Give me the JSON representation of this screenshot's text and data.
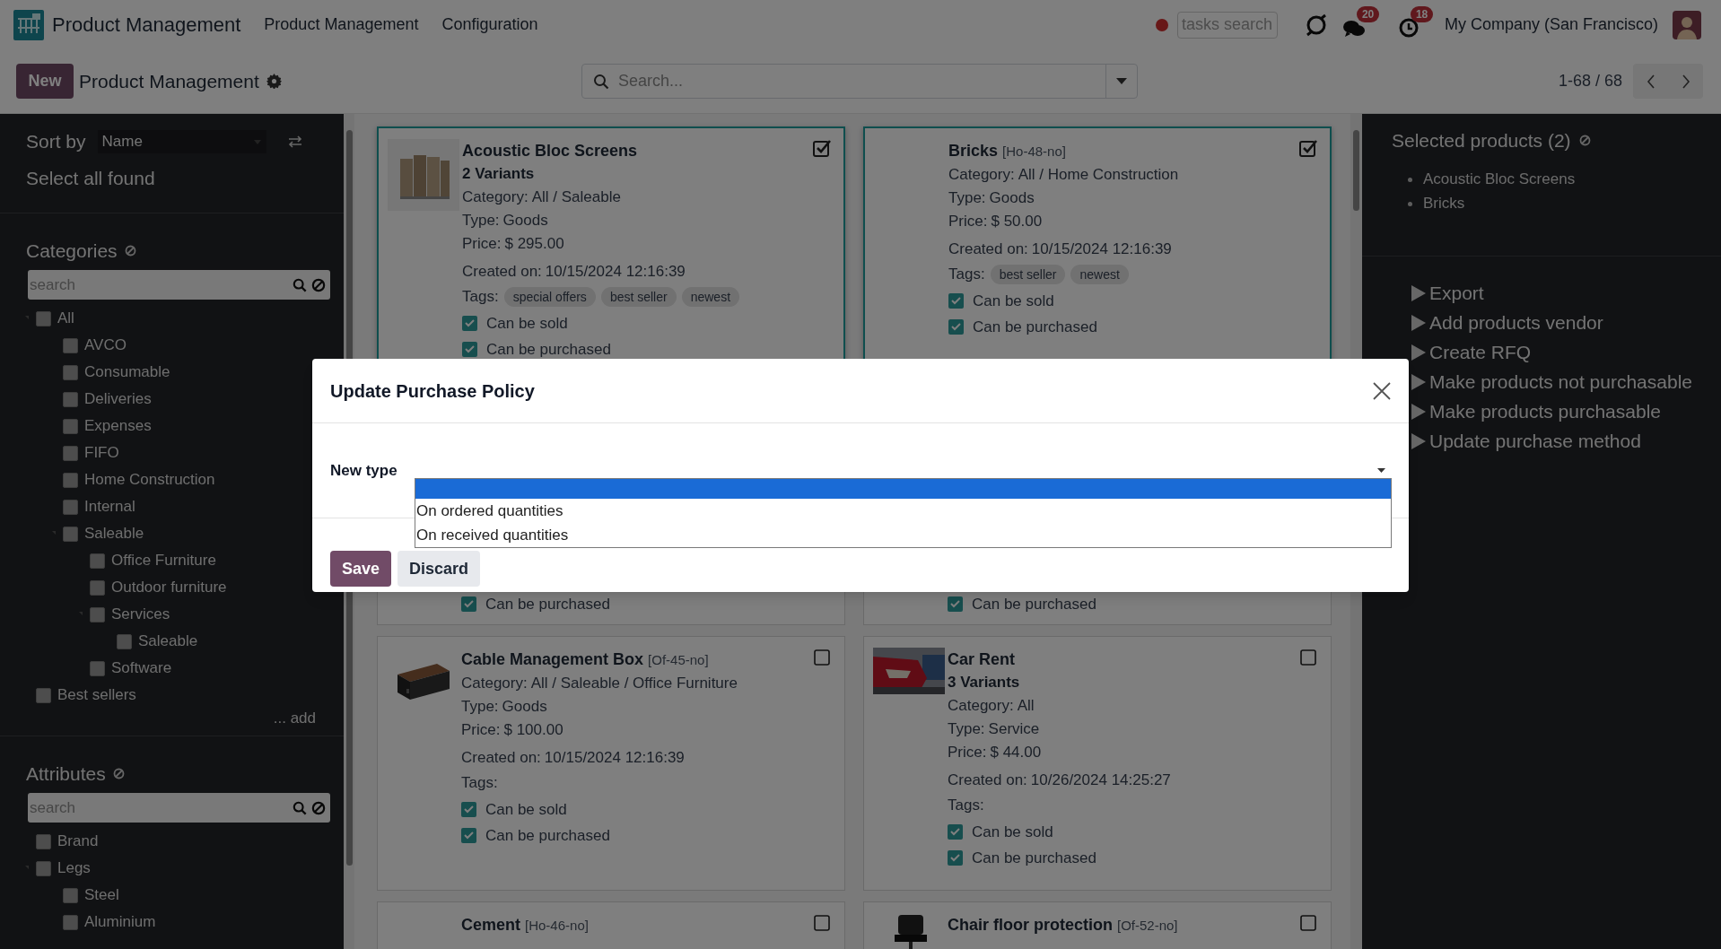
{
  "topbar": {
    "app_name": "Product Management",
    "menu": [
      "Product Management",
      "Configuration"
    ],
    "tasks_search": {
      "placeholder": "tasks search"
    },
    "messages_badge": "20",
    "activities_badge": "18",
    "company": "My Company (San Francisco)"
  },
  "control_bar": {
    "new_button": "New",
    "title": "Product Management",
    "search": {
      "placeholder": "Search..."
    },
    "pager": "1-68 / 68"
  },
  "sidebar": {
    "sort_label": "Sort by",
    "sort_value": "Name",
    "select_all": "Select all found",
    "sections": [
      {
        "title": "Categories",
        "search_placeholder": "search",
        "add_link": "... add",
        "items": [
          {
            "label": "All",
            "checked": false,
            "children": [
              {
                "label": "AVCO",
                "checked": false
              },
              {
                "label": "Consumable",
                "checked": false
              },
              {
                "label": "Deliveries",
                "checked": false
              },
              {
                "label": "Expenses",
                "checked": false
              },
              {
                "label": "FIFO",
                "checked": false
              },
              {
                "label": "Home Construction",
                "checked": false
              },
              {
                "label": "Internal",
                "checked": false
              },
              {
                "label": "Saleable",
                "checked": false,
                "children": [
                  {
                    "label": "Office Furniture",
                    "checked": false
                  },
                  {
                    "label": "Outdoor furniture",
                    "checked": false
                  },
                  {
                    "label": "Services",
                    "checked": false,
                    "children": [
                      {
                        "label": "Saleable",
                        "checked": false
                      }
                    ]
                  },
                  {
                    "label": "Software",
                    "checked": false
                  }
                ]
              }
            ]
          },
          {
            "label": "Best sellers",
            "checked": false
          }
        ]
      },
      {
        "title": "Attributes",
        "search_placeholder": "search",
        "items": [
          {
            "label": "Brand",
            "checked": false
          },
          {
            "label": "Legs",
            "checked": false,
            "children": [
              {
                "label": "Steel",
                "checked": false
              },
              {
                "label": "Aluminium",
                "checked": false
              }
            ]
          }
        ]
      }
    ]
  },
  "cards": [
    {
      "image": {
        "kind": "picture"
      },
      "title": "Acoustic Bloc Screens",
      "variants": "2 Variants",
      "fields": [
        {
          "label": "Category:",
          "value": "All / Saleable"
        },
        {
          "label": "Type:",
          "value": "Goods"
        },
        {
          "label": "Price:",
          "value": "$ 295.00"
        },
        {
          "label": "Created on:",
          "value": "10/15/2024 12:16:39"
        }
      ],
      "tags": {
        "label": "Tags:",
        "values": [
          "special offers",
          "best seller",
          "newest"
        ]
      },
      "flags": [
        {
          "label": "Can be sold",
          "checked": true
        },
        {
          "label": "Can be purchased",
          "checked": true
        }
      ],
      "selected": true
    },
    {
      "title": "Bricks",
      "code": "[Ho-48-no]",
      "fields": [
        {
          "label": "Category:",
          "value": "All / Home Construction"
        },
        {
          "label": "Type:",
          "value": "Goods"
        },
        {
          "label": "Price:",
          "value": "$ 50.00"
        },
        {
          "label": "Created on:",
          "value": "10/15/2024 12:16:39"
        }
      ],
      "tags": {
        "label": "Tags:",
        "values": [
          "best seller",
          "newest"
        ]
      },
      "flags": [
        {
          "label": "Can be sold",
          "checked": true
        },
        {
          "label": "Can be purchased",
          "checked": true
        }
      ],
      "selected": true
    },
    {
      "flags": [
        {
          "label": "Can be purchased",
          "checked": true
        }
      ],
      "selected": false
    },
    {
      "flags": [
        {
          "label": "Can be purchased",
          "checked": true
        }
      ],
      "selected": false
    },
    {
      "image": {
        "kind": "picture"
      },
      "title": "Cable Management Box",
      "code": "[Of-45-no]",
      "fields": [
        {
          "label": "Category:",
          "value": "All / Saleable / Office Furniture"
        },
        {
          "label": "Type:",
          "value": "Goods"
        },
        {
          "label": "Price:",
          "value": "$ 100.00"
        },
        {
          "label": "Created on:",
          "value": "10/15/2024 12:16:39"
        }
      ],
      "tags": {
        "label": "Tags:"
      },
      "flags": [
        {
          "label": "Can be sold",
          "checked": true
        },
        {
          "label": "Can be purchased",
          "checked": true
        }
      ],
      "selected": false
    },
    {
      "image": {
        "kind": "picture"
      },
      "title": "Car Rent",
      "variants": "3 Variants",
      "fields": [
        {
          "label": "Category:",
          "value": "All"
        },
        {
          "label": "Type:",
          "value": "Service"
        },
        {
          "label": "Price:",
          "value": "$ 44.00"
        },
        {
          "label": "Created on:",
          "value": "10/26/2024 14:25:27"
        }
      ],
      "tags": {
        "label": "Tags:"
      },
      "flags": [
        {
          "label": "Can be sold",
          "checked": true
        },
        {
          "label": "Can be purchased",
          "checked": true
        }
      ],
      "selected": false
    },
    {
      "title": "Cement",
      "code": "[Ho-46-no]",
      "selected": false
    },
    {
      "image": {
        "kind": "picture"
      },
      "title": "Chair floor protection",
      "code": "[Of-52-no]",
      "selected": false
    }
  ],
  "selection_panel": {
    "title": "Selected products (2)",
    "items": [
      "Acoustic Bloc Screens",
      "Bricks"
    ],
    "actions": [
      "Export",
      "Add products vendor",
      "Create RFQ",
      "Make products not purchasable",
      "Make products purchasable",
      "Update purchase method"
    ]
  },
  "dialog": {
    "title": "Update Purchase Policy",
    "field_label": "New type",
    "blank_option_highlighted": true,
    "options": [
      {
        "label": "On ordered quantities",
        "selected": false
      },
      {
        "label": "On received quantities",
        "selected": false
      }
    ],
    "buttons": [
      {
        "label": "Save",
        "kind": "primary"
      },
      {
        "label": "Discard",
        "kind": "secondary"
      }
    ]
  }
}
